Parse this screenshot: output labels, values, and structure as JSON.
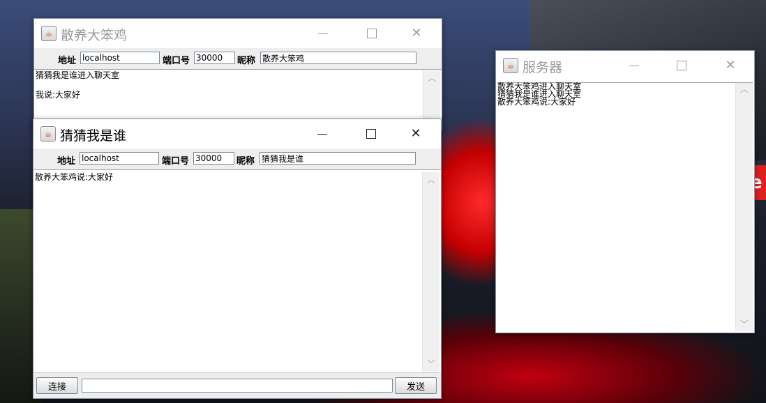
{
  "desktop": {
    "edge_text": "e"
  },
  "win1": {
    "title": "散养大笨鸡",
    "addr_label": "地址",
    "addr_value": "localhost",
    "port_label": "端口号",
    "port_value": "30000",
    "nick_label": "昵称",
    "nick_value": "散养大笨鸡",
    "messages": [
      "猜猜我是谁进入聊天室",
      "",
      "我说:大家好"
    ]
  },
  "win2": {
    "title": "猜猜我是谁",
    "addr_label": "地址",
    "addr_value": "localhost",
    "port_label": "端口号",
    "port_value": "30000",
    "nick_label": "昵称",
    "nick_value": "猜猜我是谁",
    "messages": [
      "散养大笨鸡说:大家好"
    ],
    "connect_label": "连接",
    "send_label": "发送",
    "input_value": ""
  },
  "server": {
    "title": "服务器",
    "messages": [
      "散养大笨鸡进入聊天室",
      "猜猜我是谁进入聊天室",
      "散养大笨鸡说:大家好"
    ]
  },
  "icons": {
    "app": "java-cup-icon",
    "minimize": "minimize-icon",
    "maximize": "maximize-icon",
    "close": "close-icon"
  }
}
